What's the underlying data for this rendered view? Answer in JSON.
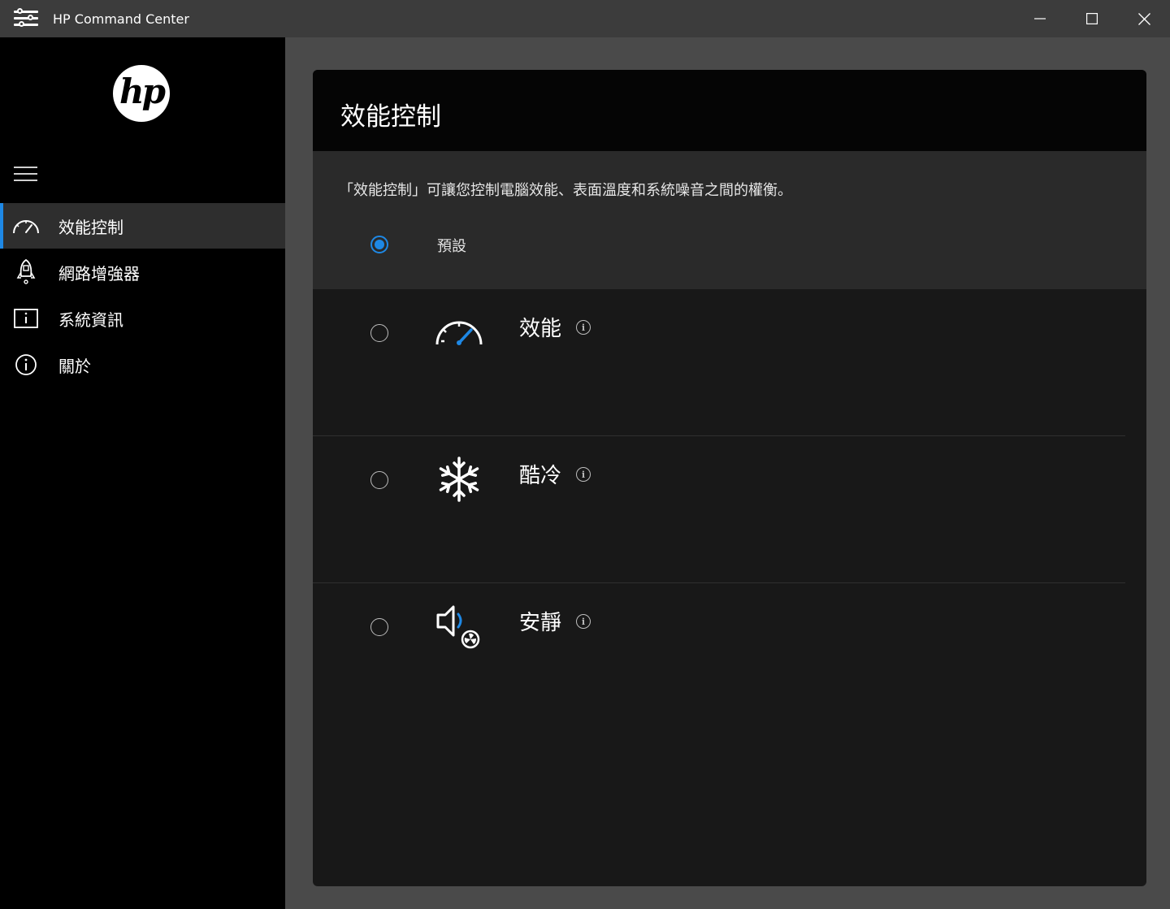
{
  "window": {
    "title": "HP Command Center",
    "icons": {
      "app": "settings-sliders-icon",
      "minimize": "minimize-icon",
      "maximize": "maximize-icon",
      "close": "close-icon"
    }
  },
  "sidebar": {
    "logo_text": "hp",
    "items": [
      {
        "label": "效能控制",
        "icon": "speedometer-icon",
        "active": true
      },
      {
        "label": "網路增強器",
        "icon": "rocket-icon",
        "active": false
      },
      {
        "label": "系統資訊",
        "icon": "info-box-icon",
        "active": false
      },
      {
        "label": "關於",
        "icon": "info-circle-icon",
        "active": false
      }
    ]
  },
  "main": {
    "title": "效能控制",
    "description": "「效能控制」可讓您控制電腦效能、表面溫度和系統噪音之間的權衡。",
    "default_option": {
      "label": "預設",
      "selected": true
    },
    "modes": [
      {
        "label": "效能",
        "icon": "speedometer-icon",
        "selected": false
      },
      {
        "label": "酷冷",
        "icon": "snowflake-icon",
        "selected": false
      },
      {
        "label": "安靜",
        "icon": "speaker-fan-icon",
        "selected": false
      }
    ]
  },
  "colors": {
    "accent": "#1e88e5",
    "sidebar_bg": "#000000",
    "titlebar_bg": "#3c3c3c",
    "panel_bg": "#181818"
  }
}
